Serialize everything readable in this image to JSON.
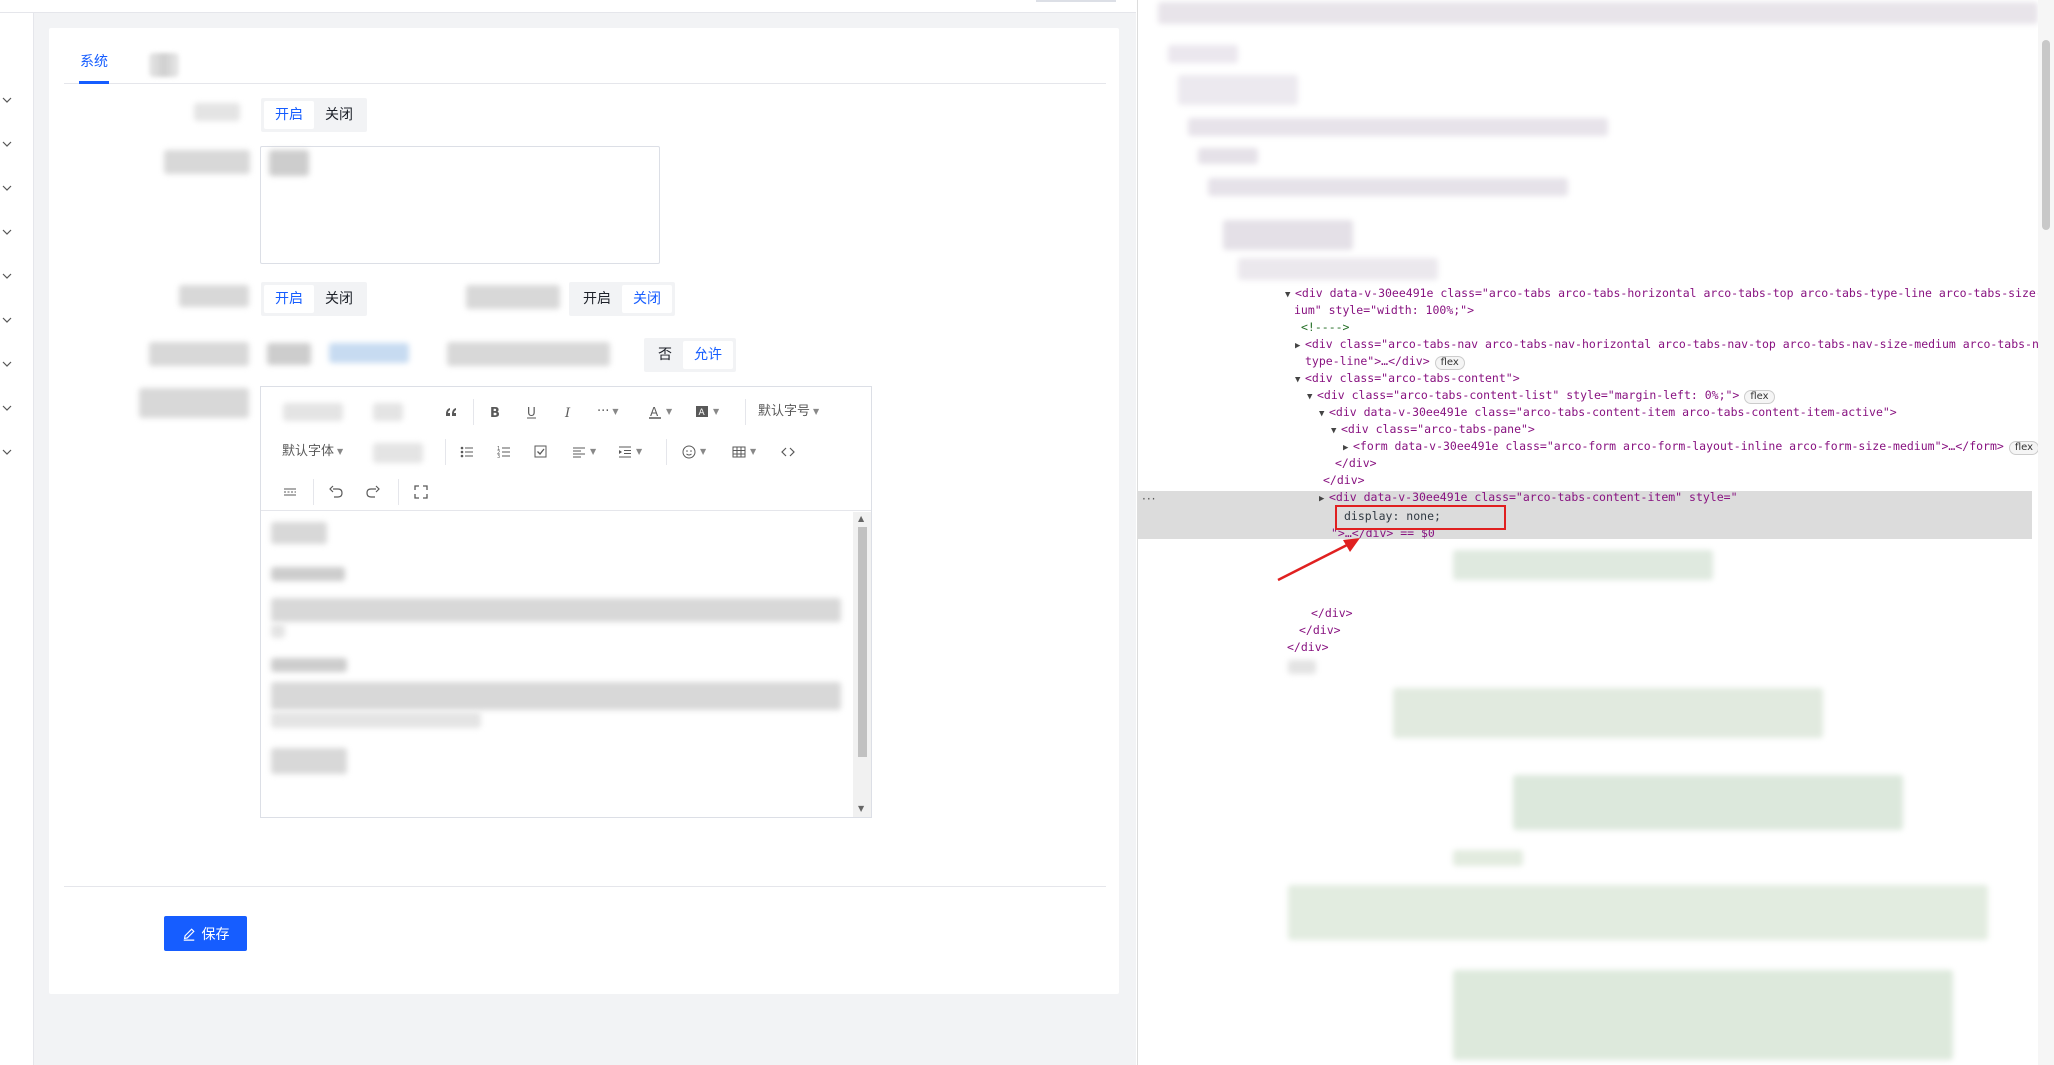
{
  "tabs": {
    "active": "系统"
  },
  "form": {
    "toggle1": {
      "on": "开启",
      "off": "关闭",
      "selected": "on"
    },
    "toggle2": {
      "on": "开启",
      "off": "关闭",
      "selected": "on"
    },
    "toggle3": {
      "on": "开启",
      "off": "关闭",
      "selected": "off"
    },
    "toggle4": {
      "no": "否",
      "yes": "允许",
      "selected": "yes"
    }
  },
  "editor": {
    "font_size": "默认字号",
    "font_family": "默认字体"
  },
  "footer": {
    "save_label": "保存"
  },
  "devtools": {
    "l1_a": "<div data-v-30ee491e class=\"arco-tabs arco-tabs-horizontal arco-tabs-top arco-tabs-type-line arco-tabs-size-med",
    "l1_b": "ium\" style=\"width: 100%;\">",
    "l2": "<!---->",
    "l3_a": "<div class=\"arco-tabs-nav arco-tabs-nav-horizontal arco-tabs-nav-top arco-tabs-nav-size-medium arco-tabs-nav-",
    "l3_b": "type-line\">…</div>",
    "l4": "<div class=\"arco-tabs-content\">",
    "l5": "<div class=\"arco-tabs-content-list\" style=\"margin-left: 0%;\">",
    "l6": "<div data-v-30ee491e class=\"arco-tabs-content-item arco-tabs-content-item-active\">",
    "l7": "<div class=\"arco-tabs-pane\">",
    "l8": "<form data-v-30ee491e class=\"arco-form arco-form-layout-inline arco-form-size-medium\">…</form>",
    "l9": "</div>",
    "l10": "</div>",
    "l11": "<div data-v-30ee491e class=\"arco-tabs-content-item\" style=\"",
    "l12": "display: none;",
    "l13": "\">…</div> == $0",
    "l14": "</div>",
    "l15": "</div>",
    "l16": "</div>",
    "flex": "flex",
    "dots": "···"
  },
  "colors": {
    "primary": "#165dff",
    "highlight": "#e02020",
    "devtools_tag": "#881280"
  }
}
